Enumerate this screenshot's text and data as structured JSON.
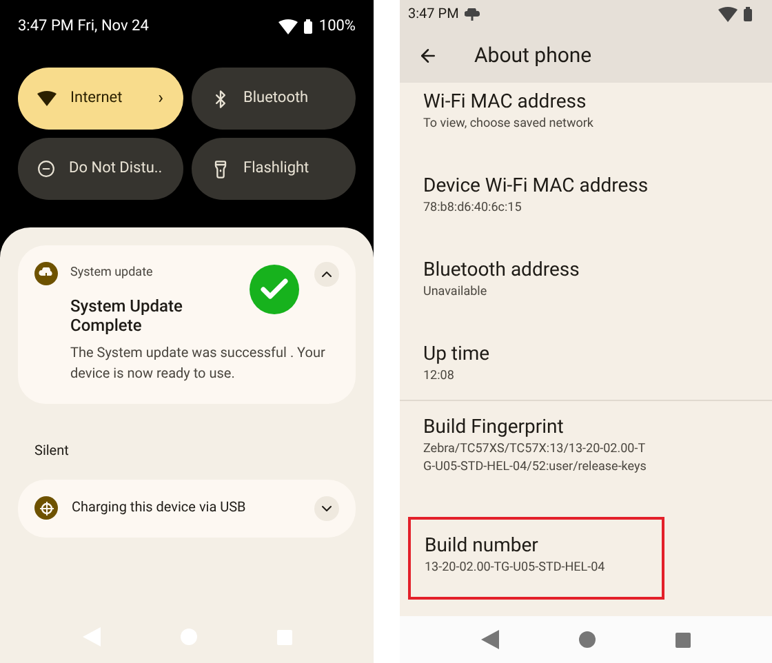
{
  "left_phone": {
    "status_bar": {
      "time": "3:47 PM Fri, Nov 24",
      "battery": "100%"
    },
    "tiles": [
      {
        "label": "Internet",
        "on": true,
        "kind": "wifi",
        "chevron": "›"
      },
      {
        "label": "Bluetooth",
        "on": false,
        "kind": "bluetooth"
      },
      {
        "label": "Do Not Distu..",
        "on": false,
        "kind": "dnd"
      },
      {
        "label": "Flashlight",
        "on": false,
        "kind": "flashlight"
      }
    ],
    "notification": {
      "app": "System update",
      "title": "System Update Complete",
      "body": "The System update was successful . Your device is now ready to use.",
      "expanded": true
    },
    "section_label": "Silent",
    "silent_notification": {
      "title": "Charging this device via USB",
      "expanded": false
    }
  },
  "right_phone": {
    "status_bar": {
      "time": "3:47 PM"
    },
    "title": "About phone",
    "items": [
      {
        "title": "Wi-Fi MAC address",
        "value": "To view, choose saved network",
        "highlighted": false
      },
      {
        "title": "Device Wi-Fi MAC address",
        "value": "78:b8:d6:40:6c:15",
        "highlighted": false
      },
      {
        "title": "Bluetooth address",
        "value": "Unavailable",
        "highlighted": false
      },
      {
        "title": "Up time",
        "value": "12:08",
        "highlighted": false
      },
      {
        "title": "Build Fingerprint",
        "value": "Zebra/TC57XS/TC57X:13/13-20-02.00-TG-U05-STD-HEL-04/52:user/release-keys",
        "highlighted": false
      },
      {
        "title": "Build number",
        "value": "13-20-02.00-TG-U05-STD-HEL-04",
        "highlighted": true
      }
    ]
  }
}
